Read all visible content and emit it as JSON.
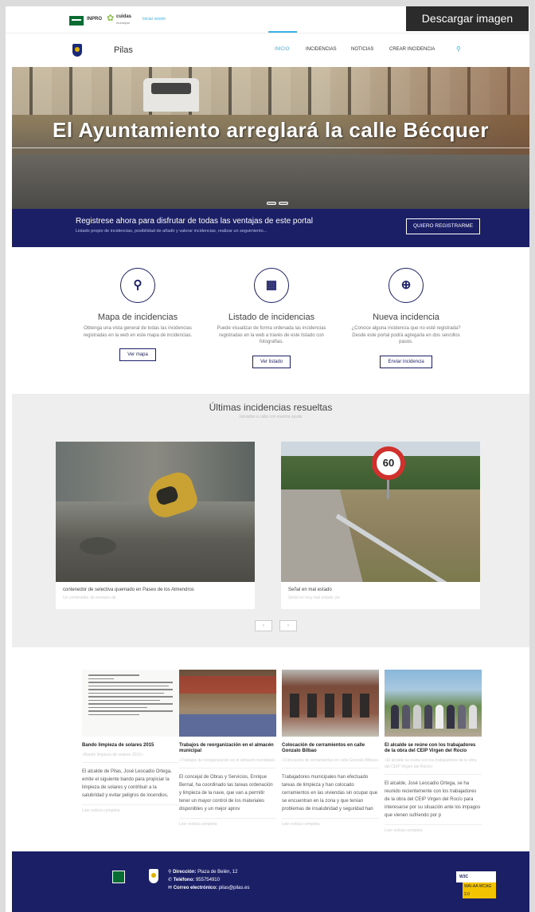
{
  "topbar": {
    "inpro": "INPRO",
    "cuidas": "cuidas",
    "cuidas_sub": "municipio",
    "login": "Iniciar sesión",
    "download_label": "Descargar imagen"
  },
  "nav": {
    "site_name": "Pilas",
    "items": [
      "Inicio",
      "Incidencias",
      "Noticias",
      "Crear incidencia"
    ]
  },
  "hero": {
    "title": "El Ayuntamiento arreglará la calle Bécquer"
  },
  "register": {
    "title": "Registrese ahora para disfrutar de todas las ventajas de este portal",
    "subtitle": "Listado propio de incidencias, posibilidad de añadir y valorar incidencias, realizar un seguimiento...",
    "button": "QUIERO REGISTRARME"
  },
  "features": [
    {
      "icon": "map-marker-icon",
      "title": "Mapa de incidencias",
      "desc": "Obtenga una vista general de todas las incidencias registradas en la web en este mapa de incidencias.",
      "button": "Ver mapa"
    },
    {
      "icon": "grid-list-icon",
      "title": "Listado de incidencias",
      "desc": "Puede visualizar de forma ordenada las incidencias registradas en la web a través de este listado con fotografías.",
      "button": "Ver listado"
    },
    {
      "icon": "plus-circle-icon",
      "title": "Nueva incidencia",
      "desc": "¿Conoce alguna incidencia que no esté registrada? Desde este portal podrá agregarla en dos sencillos pasos.",
      "button": "Enviar incidencia"
    }
  ],
  "resolved": {
    "title": "Últimas incidencias resueltas",
    "subtitle": "Llevadas a cabo con vuestra ayuda",
    "cards": [
      {
        "title": "contenedor de selectiva quemado en Paseo de los Almendros",
        "sub": "Un contenedor de envases de"
      },
      {
        "title": "Señal en mal estado",
        "sub": "Señal en muy mal estado, pe"
      }
    ],
    "prev": "‹",
    "next": "›"
  },
  "news": [
    {
      "title": "Bando limpieza de solares 2015",
      "sub": "«Bando limpieza de solares 2015»",
      "body": "El alcalde de Pilas, José Leocadio Ortega, emite el siguiente bando para propiciar la limpieza de solares y contribuir a la salubridad y evitar peligros de incendios.",
      "more": "Leer noticia completa"
    },
    {
      "title": "Trabajos de reorganización en el almacén municipal",
      "sub": "«Trabajos de reorganización en el almacén municipal»",
      "body": "El concejal de Obras y Servicios, Enrique Bernal, ha coordinado las tareas ordenación y limpieza de la nave, que van a permitir tener un mayor control de los materiales disponibles y un mejor aprov",
      "more": "Leer noticia completa"
    },
    {
      "title": "Colocación de cerramientos en calle Gonzalo Bilbao",
      "sub": "«Colocación de cerramientos en calle Gonzalo Bilbao»",
      "body": "Trabajadores municipales han efectuado tareas de limpieza y han colocado cerramientos en las viviendas sin ocupar que se encuentran en la zona y que tenían problemas de insalubridad y seguridad han",
      "more": "Leer noticia completa"
    },
    {
      "title": "El alcalde se reúne con los trabajadores de la obra del CEIP Virgen del Rocío",
      "sub": "«El alcalde se reúne con los trabajadores de la obra del CEIP Virgen del Rocío»",
      "body": "El alcalde, José Leocadio Ortega, se ha reunido recientemente con los trabajadores de la obra del CEIP Virgen del Rocío para interesarse por su situación ante los impagos que vienen sufriendo por p",
      "more": "Leer noticia completa"
    }
  ],
  "footer": {
    "address_label": "Dirección:",
    "address": "Plaza de Belén, 12",
    "phone_label": "Teléfono:",
    "phone": "955754910",
    "email_label": "Correo electrónico:",
    "email": "pilas@pilas.es",
    "wcag": "W3C",
    "wcag_level": "WAI-AA WCAG 2.0"
  },
  "colors": {
    "navy": "#1b1f66",
    "accent": "#3ab1e6"
  }
}
